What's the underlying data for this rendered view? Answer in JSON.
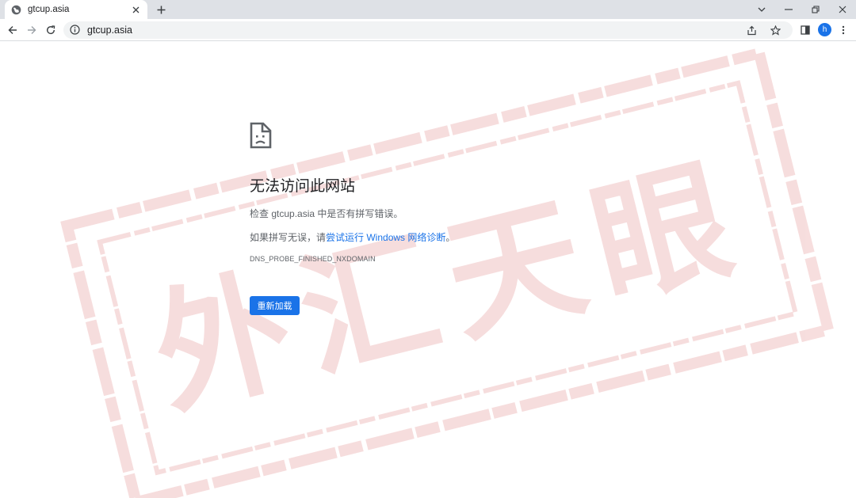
{
  "tab": {
    "title": "gtcup.asia",
    "favicon": "globe-icon"
  },
  "omnibox": {
    "url": "gtcup.asia"
  },
  "profile": {
    "initial": "h"
  },
  "error": {
    "title": "无法访问此网站",
    "check_prefix": "检查 ",
    "check_domain": "gtcup.asia",
    "check_suffix": " 中是否有拼写错误。",
    "hint_prefix": "如果拼写无误，请",
    "hint_link": "尝试运行 Windows 网络诊断",
    "hint_suffix": "。",
    "code": "DNS_PROBE_FINISHED_NXDOMAIN",
    "reload_label": "重新加载"
  },
  "watermark": {
    "text": "外汇天眼",
    "color": "#e8a0a0"
  },
  "colors": {
    "accent": "#1a73e8",
    "tabstrip": "#dee1e6",
    "omnibox": "#f1f3f4"
  }
}
